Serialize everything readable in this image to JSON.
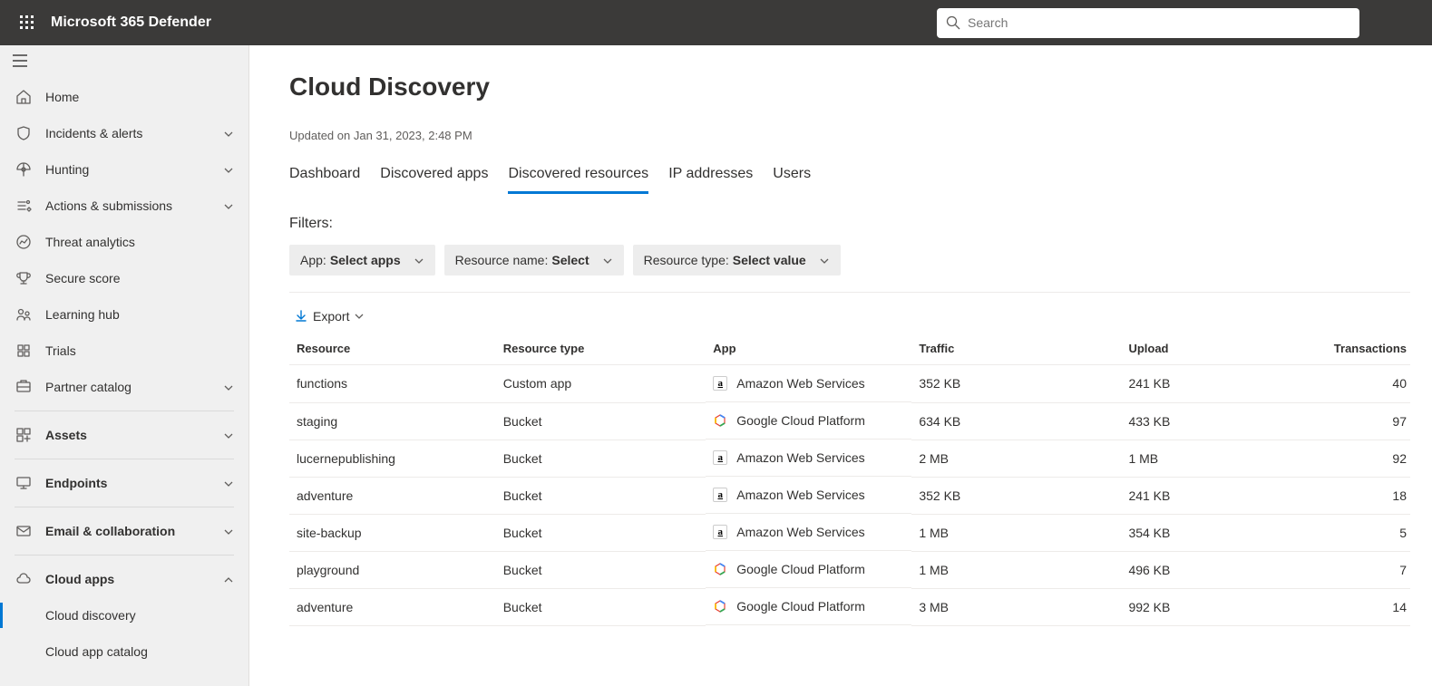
{
  "header": {
    "brand": "Microsoft 365 Defender",
    "search_placeholder": "Search"
  },
  "sidebar": {
    "items": [
      {
        "label": "Home",
        "icon": "home"
      },
      {
        "label": "Incidents & alerts",
        "icon": "shield",
        "chev": true
      },
      {
        "label": "Hunting",
        "icon": "target",
        "chev": true
      },
      {
        "label": "Actions & submissions",
        "icon": "actions",
        "chev": true
      },
      {
        "label": "Threat analytics",
        "icon": "analytics"
      },
      {
        "label": "Secure score",
        "icon": "trophy"
      },
      {
        "label": "Learning hub",
        "icon": "learn"
      },
      {
        "label": "Trials",
        "icon": "trials"
      },
      {
        "label": "Partner catalog",
        "icon": "partner",
        "chev": true
      },
      {
        "divider": true
      },
      {
        "label": "Assets",
        "icon": "assets",
        "chev": true,
        "bold": true
      },
      {
        "divider": true
      },
      {
        "label": "Endpoints",
        "icon": "endpoints",
        "chev": true,
        "bold": true
      },
      {
        "divider": true
      },
      {
        "label": "Email & collaboration",
        "icon": "email",
        "chev": true,
        "bold": true
      },
      {
        "divider": true
      },
      {
        "label": "Cloud apps",
        "icon": "cloud",
        "chev": true,
        "bold": true,
        "expanded": true
      },
      {
        "label": "Cloud discovery",
        "sub": true,
        "active": true
      },
      {
        "label": "Cloud app catalog",
        "sub": true
      }
    ]
  },
  "page": {
    "title": "Cloud Discovery",
    "updated": "Updated on Jan 31, 2023, 2:48 PM",
    "tabs": [
      "Dashboard",
      "Discovered apps",
      "Discovered resources",
      "IP addresses",
      "Users"
    ],
    "active_tab": 2,
    "filters_label": "Filters:",
    "filters": [
      {
        "label": "App:",
        "value": "Select apps"
      },
      {
        "label": "Resource name:",
        "value": "Select"
      },
      {
        "label": "Resource type:",
        "value": "Select value"
      }
    ],
    "export_label": "Export",
    "columns": [
      "Resource",
      "Resource type",
      "App",
      "Traffic",
      "Upload",
      "Transactions"
    ],
    "rows": [
      {
        "resource": "functions",
        "type": "Custom app",
        "app": "Amazon Web Services",
        "app_icon": "aws",
        "traffic": "352 KB",
        "upload": "241 KB",
        "tx": "40"
      },
      {
        "resource": "staging",
        "type": "Bucket",
        "app": "Google Cloud Platform",
        "app_icon": "gcp",
        "traffic": "634 KB",
        "upload": "433 KB",
        "tx": "97"
      },
      {
        "resource": "lucernepublishing",
        "type": "Bucket",
        "app": "Amazon Web Services",
        "app_icon": "aws",
        "traffic": "2 MB",
        "upload": "1 MB",
        "tx": "92"
      },
      {
        "resource": "adventure",
        "type": "Bucket",
        "app": "Amazon Web Services",
        "app_icon": "aws",
        "traffic": "352 KB",
        "upload": "241 KB",
        "tx": "18"
      },
      {
        "resource": "site-backup",
        "type": "Bucket",
        "app": "Amazon Web Services",
        "app_icon": "aws",
        "traffic": "1 MB",
        "upload": "354 KB",
        "tx": "5"
      },
      {
        "resource": "playground",
        "type": "Bucket",
        "app": "Google Cloud Platform",
        "app_icon": "gcp",
        "traffic": "1 MB",
        "upload": "496 KB",
        "tx": "7"
      },
      {
        "resource": "adventure",
        "type": "Bucket",
        "app": "Google Cloud Platform",
        "app_icon": "gcp",
        "traffic": "3 MB",
        "upload": "992 KB",
        "tx": "14"
      }
    ]
  }
}
